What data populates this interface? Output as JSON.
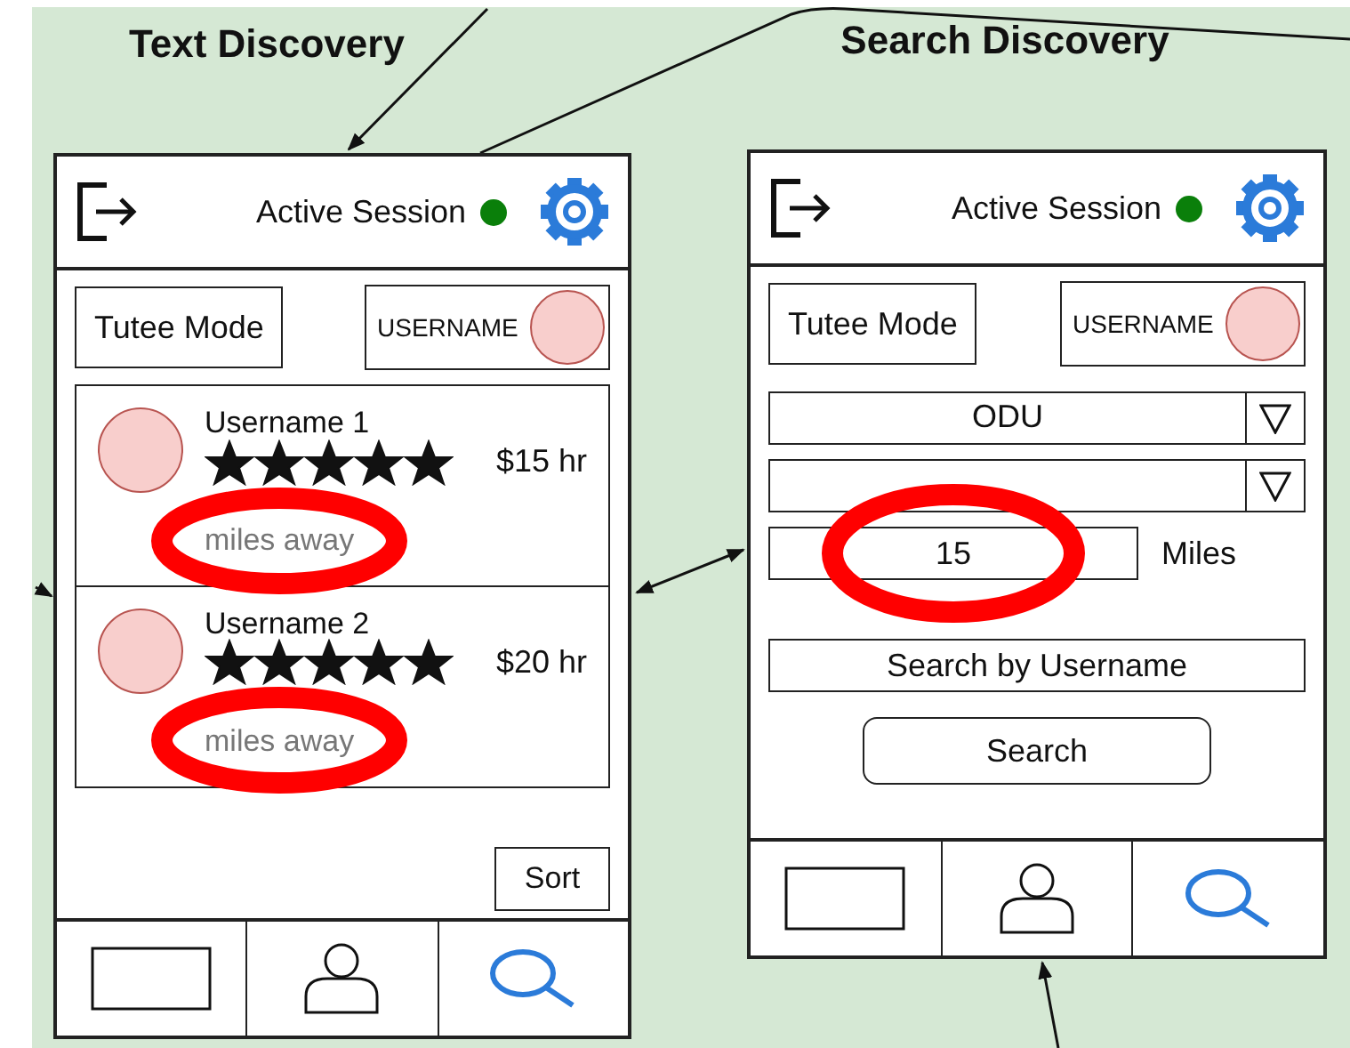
{
  "screens": [
    {
      "kind": "list",
      "title": "Text Discovery",
      "header": {
        "session_label": "Active Session",
        "session_active": true
      },
      "mode_button": "Tutee Mode",
      "user_chip": "USERNAME",
      "tutors": [
        {
          "name": "Username 1",
          "stars": 5,
          "distance": "miles away",
          "rate": "$15 hr",
          "circled": true
        },
        {
          "name": "Username 2",
          "stars": 5,
          "distance": "miles away",
          "rate": "$20 hr",
          "circled": true
        }
      ],
      "sort_button": "Sort",
      "nav": [
        {
          "kind": "rectangle",
          "selected": false
        },
        {
          "kind": "person",
          "selected": false
        },
        {
          "kind": "search",
          "selected": true
        }
      ]
    },
    {
      "kind": "search",
      "title": "Search Discovery",
      "header": {
        "session_label": "Active Session",
        "session_active": true
      },
      "mode_button": "Tutee Mode",
      "user_chip": "USERNAME",
      "filters": [
        {
          "kind": "dropdown",
          "value": "ODU"
        },
        {
          "kind": "dropdown"
        },
        {
          "kind": "number",
          "value": "15",
          "unit": "Miles",
          "circled": true
        },
        {
          "kind": "text",
          "placeholder": "Search by Username"
        }
      ],
      "search_button": "Search",
      "nav": [
        {
          "kind": "rectangle",
          "selected": false
        },
        {
          "kind": "person",
          "selected": false
        },
        {
          "kind": "search",
          "selected": true
        }
      ]
    }
  ]
}
